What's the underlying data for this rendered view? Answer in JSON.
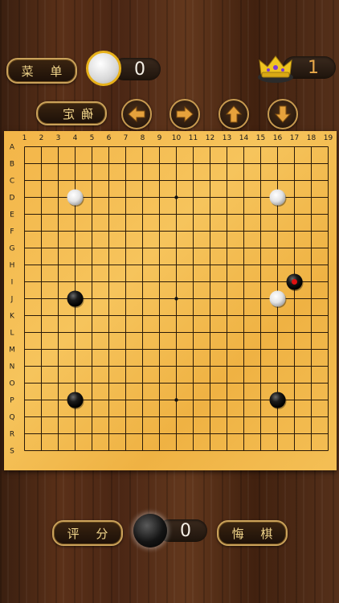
{
  "toolbar": {
    "menu_label": "菜 单",
    "confirm_label": "确定",
    "left_icon": "arrow-left-icon",
    "right_icon": "arrow-right-icon",
    "up_icon": "arrow-up-icon",
    "down_icon": "arrow-down-icon"
  },
  "top_player": {
    "stone": "white",
    "score": "0",
    "crown_icon": "crown-icon",
    "crown_count": "1"
  },
  "bottom_player": {
    "stone": "black",
    "score": "0"
  },
  "bottom_bar": {
    "evaluate_label": "评 分",
    "undo_label": "悔 棋"
  },
  "board": {
    "columns": [
      "1",
      "2",
      "3",
      "4",
      "5",
      "6",
      "7",
      "8",
      "9",
      "10",
      "11",
      "12",
      "13",
      "14",
      "15",
      "16",
      "17",
      "18",
      "19"
    ],
    "rows": [
      "A",
      "B",
      "C",
      "D",
      "E",
      "F",
      "G",
      "H",
      "I",
      "J",
      "K",
      "L",
      "M",
      "N",
      "O",
      "P",
      "Q",
      "R",
      "S"
    ],
    "star_points": [
      [
        4,
        10
      ],
      [
        10,
        10
      ],
      [
        16,
        10
      ],
      [
        4,
        4
      ],
      [
        4,
        16
      ],
      [
        10,
        4
      ],
      [
        10,
        16
      ],
      [
        16,
        4
      ],
      [
        16,
        16
      ]
    ],
    "stones": [
      {
        "color": "white",
        "col": 4,
        "row": 4
      },
      {
        "color": "white",
        "col": 16,
        "row": 4
      },
      {
        "color": "white",
        "col": 16,
        "row": 10
      },
      {
        "color": "black",
        "col": 4,
        "row": 10
      },
      {
        "color": "black",
        "col": 17,
        "row": 9,
        "last": true
      },
      {
        "color": "black",
        "col": 4,
        "row": 16
      },
      {
        "color": "black",
        "col": 16,
        "row": 16
      }
    ],
    "colors": {
      "board": "#f3b548",
      "line": "#2a1a08",
      "last_move_marker": "#e01010"
    }
  }
}
